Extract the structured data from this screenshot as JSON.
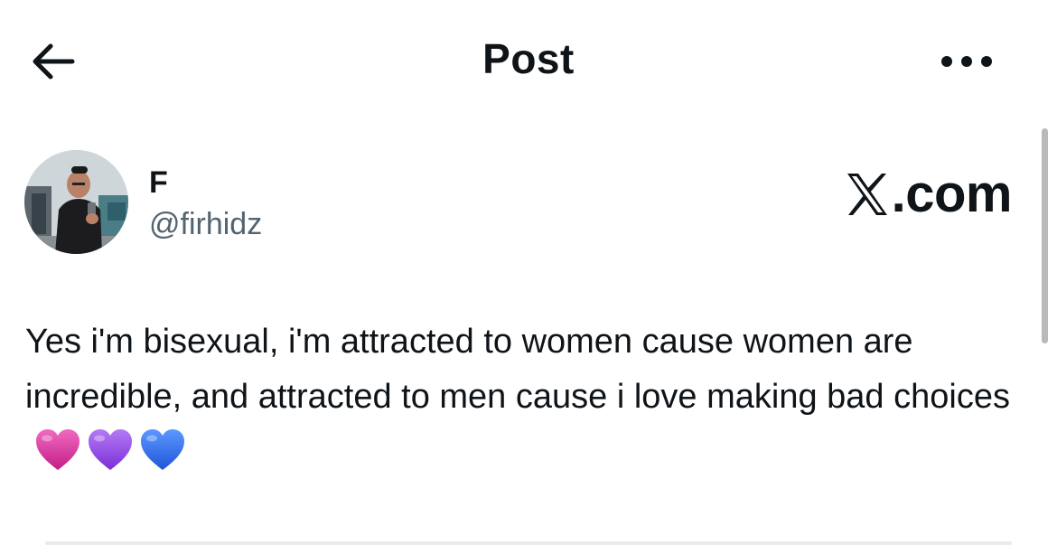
{
  "header": {
    "back_icon": "arrow-left-icon",
    "title": "Post",
    "more_icon": "more-horizontal-icon"
  },
  "post": {
    "author": {
      "display_name": "F",
      "handle": "@firhidz",
      "avatar_icon": "profile-photo"
    },
    "watermark": ".com",
    "watermark_logo": "x-logo-icon",
    "text": "Yes i'm bisexual, i'm attracted to women cause women are incredible, and attracted to men cause i love making bad choices",
    "emojis": [
      {
        "name": "pink-heart-icon",
        "color": "#e0399a"
      },
      {
        "name": "purple-heart-icon",
        "color": "#9b4de6"
      },
      {
        "name": "blue-heart-icon",
        "color": "#2f6ff0"
      }
    ]
  },
  "colors": {
    "text_primary": "#0f1419",
    "text_secondary": "#536471",
    "divider": "#e9eaeb"
  }
}
